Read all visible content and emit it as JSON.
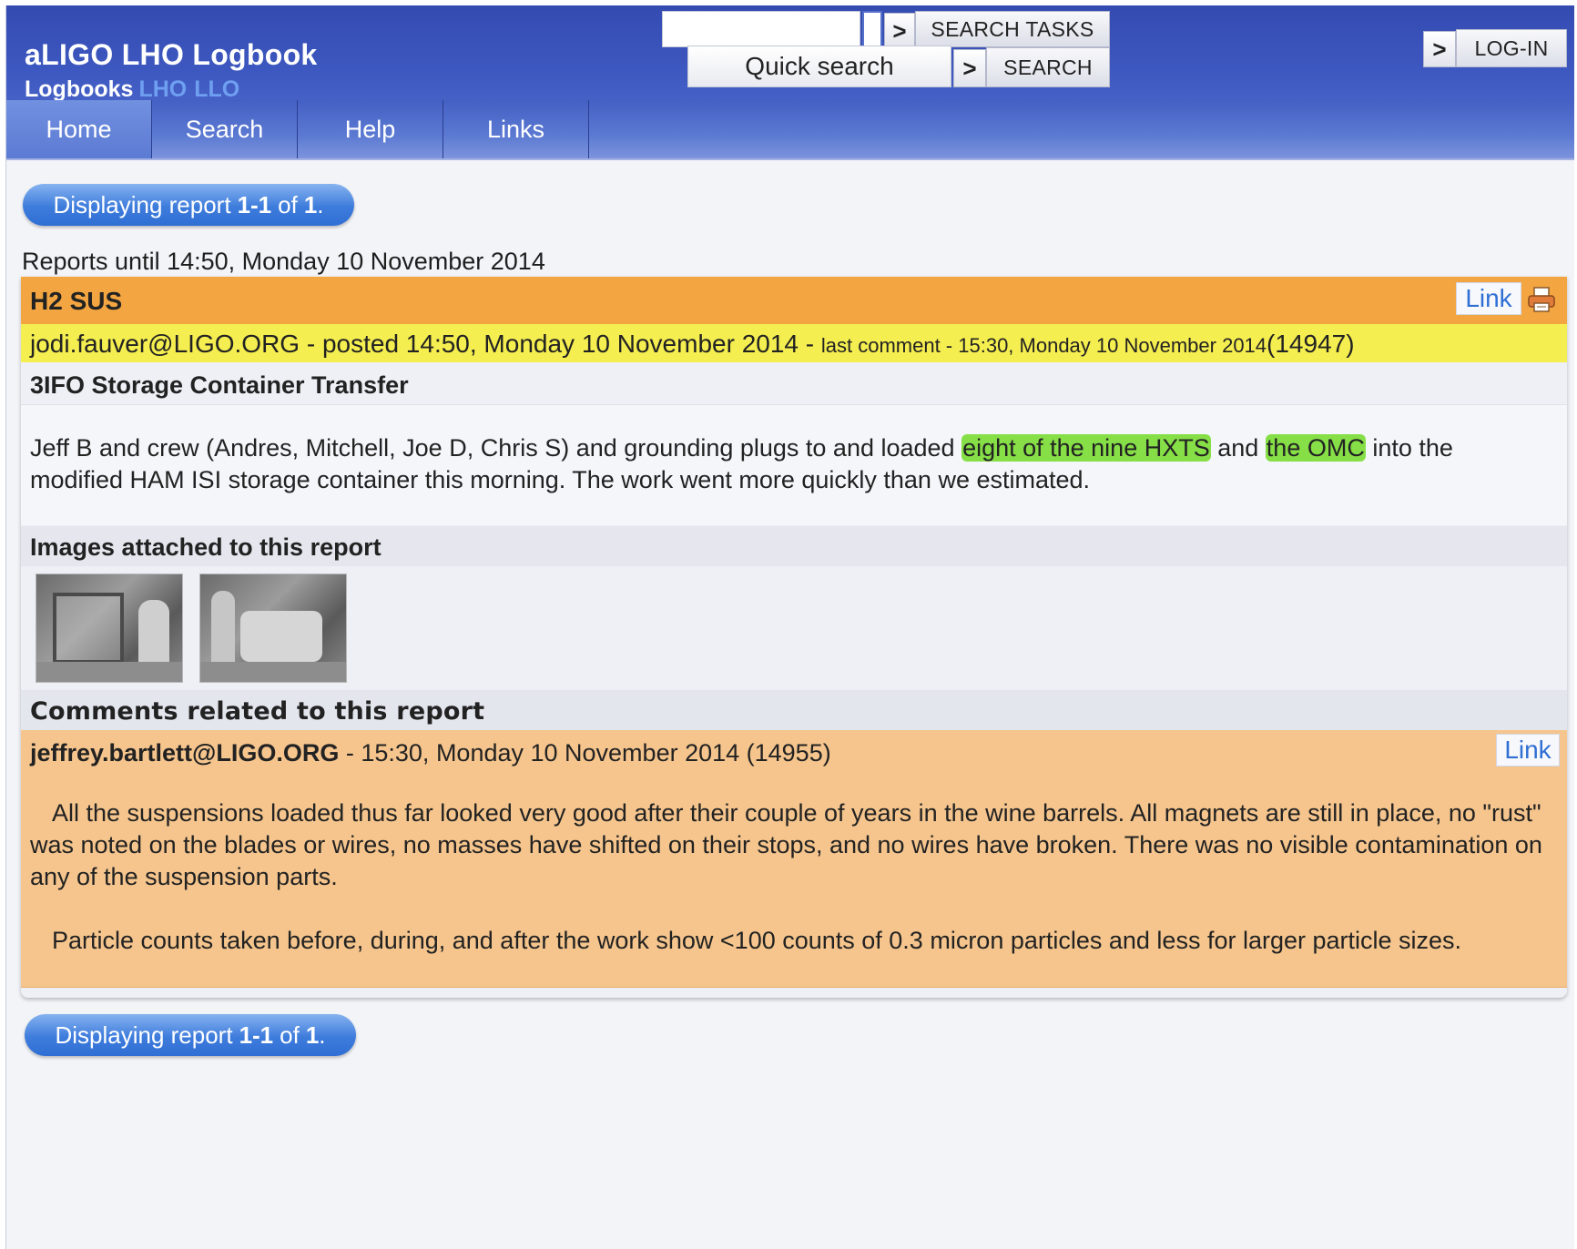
{
  "header": {
    "app_title": "aLIGO LHO Logbook",
    "logbooks_label": "Logbooks",
    "logbook_links": [
      "LHO",
      "LLO"
    ],
    "search_tasks_label": "SEARCH TASKS",
    "quick_search_placeholder": "Quick search",
    "search_label": "SEARCH",
    "login_label": "LOG-IN",
    "arrow_glyph": ">"
  },
  "nav": {
    "items": [
      "Home",
      "Search",
      "Help",
      "Links"
    ]
  },
  "pagination": {
    "prefix": "Displaying report",
    "range": "1-1",
    "of_label": "of",
    "total": "1",
    "suffix": "."
  },
  "reports_until": "Reports until 14:50, Monday 10 November 2014",
  "report": {
    "section": "H2 SUS",
    "link_label": "Link",
    "author": "jodi.fauver@LIGO.ORG",
    "posted": " - posted 14:50, Monday 10 November 2014 - ",
    "last_comment": "last comment - 15:30, Monday 10 November 2014",
    "id": "(14947)",
    "subject": "3IFO Storage Container Transfer",
    "body_part1": "Jeff B and crew (Andres, Mitchell, Joe D, Chris S) and grounding plugs to and loaded ",
    "body_highlight1": "eight of the nine HXTS",
    "body_part2": " and ",
    "body_highlight2": "the OMC",
    "body_part3": " into the modified HAM ISI storage container this morning. The work went more quickly than we estimated.",
    "images_heading": "Images attached to this report",
    "comments_heading": "Comments related to this report"
  },
  "comment": {
    "author": "jeffrey.bartlett@LIGO.ORG",
    "meta": " - 15:30, Monday 10 November 2014 (14955)",
    "link_label": "Link",
    "paragraph1": "All the suspensions loaded thus far looked very good after their couple of years in the wine barrels. All magnets are still in place, no \"rust\" was noted on the blades or wires, no masses have shifted on their stops, and no wires have broken. There was no visible contamination on any of the suspension parts.",
    "paragraph2": "Particle counts taken before, during, and after the work show <100 counts of 0.3 micron particles and less for larger particle sizes."
  },
  "colors": {
    "header_blue": "#344bb1",
    "section_orange": "#f2a540",
    "author_yellow": "#f5ee50",
    "comment_peach": "#f5c58d",
    "highlight_green": "#86df47",
    "link_blue": "#2f6fd4"
  },
  "icons": {
    "print": "printer-icon",
    "arrow": "chevron-right-icon"
  }
}
